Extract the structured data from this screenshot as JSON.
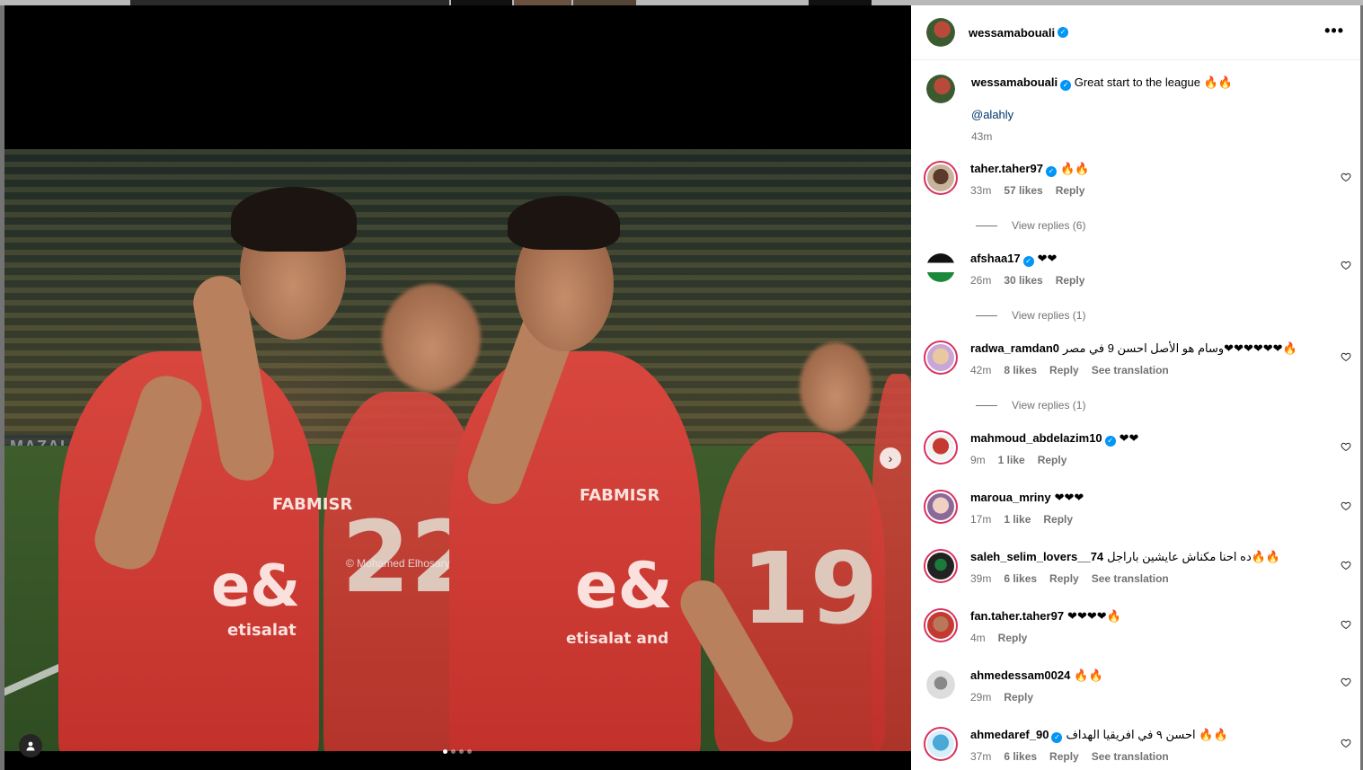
{
  "post": {
    "username": "wessamabouali",
    "caption": "Great start to the league 🔥🔥",
    "mention": "@alahly",
    "time": "43m",
    "watermark": "© Mohamed Elhosary",
    "shirt_sponsor_1": "e&",
    "shirt_sponsor_2": "etisalat and",
    "shirt_fab": "FABMISR",
    "number_left": "22",
    "number_right": "19",
    "adboard": "MAZALLO",
    "carousel_pages": 4,
    "carousel_active": 1
  },
  "comments": [
    {
      "user": "taher.taher97",
      "verified": true,
      "text": "🔥🔥",
      "time": "33m",
      "likes": "57 likes",
      "reply": "Reply",
      "see_translation": "",
      "view_replies": "View replies (6)"
    },
    {
      "user": "afshaa17",
      "verified": true,
      "text": "❤❤",
      "time": "26m",
      "likes": "30 likes",
      "reply": "Reply",
      "see_translation": "",
      "view_replies": "View replies (1)"
    },
    {
      "user": "radwa_ramdan0",
      "verified": false,
      "text": "وسام هو الأصل احسن 9 في مصر❤❤❤❤❤❤🔥",
      "time": "42m",
      "likes": "8 likes",
      "reply": "Reply",
      "see_translation": "See translation",
      "view_replies": "View replies (1)"
    },
    {
      "user": "mahmoud_abdelazim10",
      "verified": true,
      "text": "❤❤",
      "time": "9m",
      "likes": "1 like",
      "reply": "Reply",
      "see_translation": "",
      "view_replies": ""
    },
    {
      "user": "maroua_mriny",
      "verified": false,
      "text": "❤❤❤",
      "time": "17m",
      "likes": "1 like",
      "reply": "Reply",
      "see_translation": "",
      "view_replies": ""
    },
    {
      "user": "saleh_selim_lovers__74",
      "verified": false,
      "text": "ده احنا مكناش عايشين باراجل🔥🔥",
      "time": "39m",
      "likes": "6 likes",
      "reply": "Reply",
      "see_translation": "See translation",
      "view_replies": ""
    },
    {
      "user": "fan.taher.taher97",
      "verified": false,
      "text": "❤❤❤❤🔥",
      "time": "4m",
      "likes": "",
      "reply": "Reply",
      "see_translation": "",
      "view_replies": ""
    },
    {
      "user": "ahmedessam0024",
      "verified": false,
      "text": "🔥🔥",
      "time": "29m",
      "likes": "",
      "reply": "Reply",
      "see_translation": "",
      "view_replies": ""
    },
    {
      "user": "ahmedaref_90",
      "verified": true,
      "text": "احسن ٩ في افريقيا الهداف 🔥🔥",
      "time": "37m",
      "likes": "6 likes",
      "reply": "Reply",
      "see_translation": "See translation",
      "view_replies": ""
    }
  ],
  "icons": {
    "more": "more-horizontal-icon",
    "heart": "heart-outline-icon",
    "next": "chevron-right-icon",
    "usertag": "user-tag-icon",
    "verified": "verified-badge-icon"
  },
  "colors": {
    "verified": "#0095f6",
    "story_ring": "#d9325f",
    "link": "#00376b",
    "meta": "#737373",
    "shirt": "#d8473e"
  }
}
